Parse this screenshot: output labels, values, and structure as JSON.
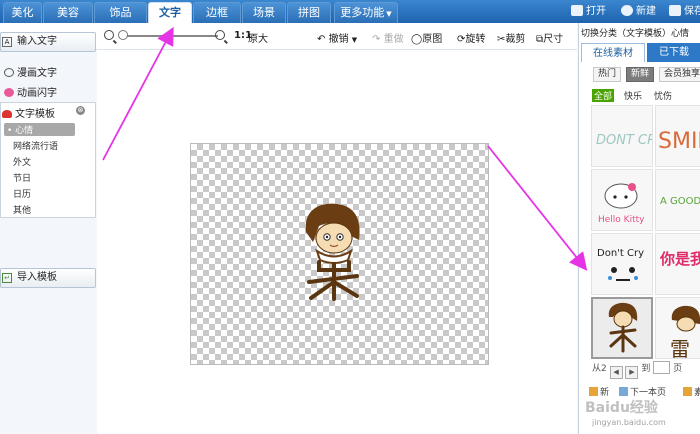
{
  "menu": {
    "tabs": [
      {
        "label": "美化"
      },
      {
        "label": "美容"
      },
      {
        "label": "饰品"
      },
      {
        "label": "文字"
      },
      {
        "label": "边框"
      },
      {
        "label": "场景"
      },
      {
        "label": "拼图"
      },
      {
        "label": "更多功能"
      }
    ],
    "active_tab": "文字",
    "right": {
      "open": "打开",
      "new": "新建",
      "save": "保存"
    }
  },
  "toolbar": {
    "ratio": "1:1",
    "original_size": "原大",
    "undo": "撤销",
    "redo": "重做",
    "original": "原图",
    "rotate": "旋转",
    "crop": "裁剪",
    "size": "尺寸"
  },
  "left_panel": {
    "input_text": "输入文字",
    "comic_text": "漫画文字",
    "animated_text": "动画闪字",
    "template_title": "文字模板",
    "template_items": [
      {
        "label": "心情"
      },
      {
        "label": "网络流行语"
      },
      {
        "label": "外文"
      },
      {
        "label": "节日"
      },
      {
        "label": "日历"
      },
      {
        "label": "其他"
      }
    ],
    "import_template": "导入模板"
  },
  "right_panel": {
    "switch_category": "切换分类（文字模板）心情",
    "tabs": {
      "online": "在线素材",
      "downloaded": "已下载"
    },
    "pills": {
      "hot": "热门",
      "fresh": "新鲜",
      "member": "会员独享"
    },
    "filters": {
      "all": "全部",
      "happy": "快乐",
      "sad": "忧伤"
    },
    "thumbnails": [
      {
        "label": "DONT CRY"
      },
      {
        "label": "SMILE"
      },
      {
        "label": "Hello Kitty"
      },
      {
        "label": "A GOOD DAY"
      },
      {
        "label": "Don't Cry"
      },
      {
        "label": "你是我"
      },
      {
        "label": "呆"
      },
      {
        "label": "雷"
      }
    ],
    "pager": {
      "prefix": "从2",
      "goto": "到",
      "page": "页"
    },
    "bottom": {
      "next": "新",
      "prev_page": "下一本页",
      "last": "素"
    }
  },
  "watermark": {
    "logo": "Baidu经验",
    "url": "jingyan.baidu.com"
  },
  "colors": {
    "menu_blue": "#2a6fb6",
    "arrow_magenta": "#e633e6",
    "filter_green": "#4aa300"
  }
}
